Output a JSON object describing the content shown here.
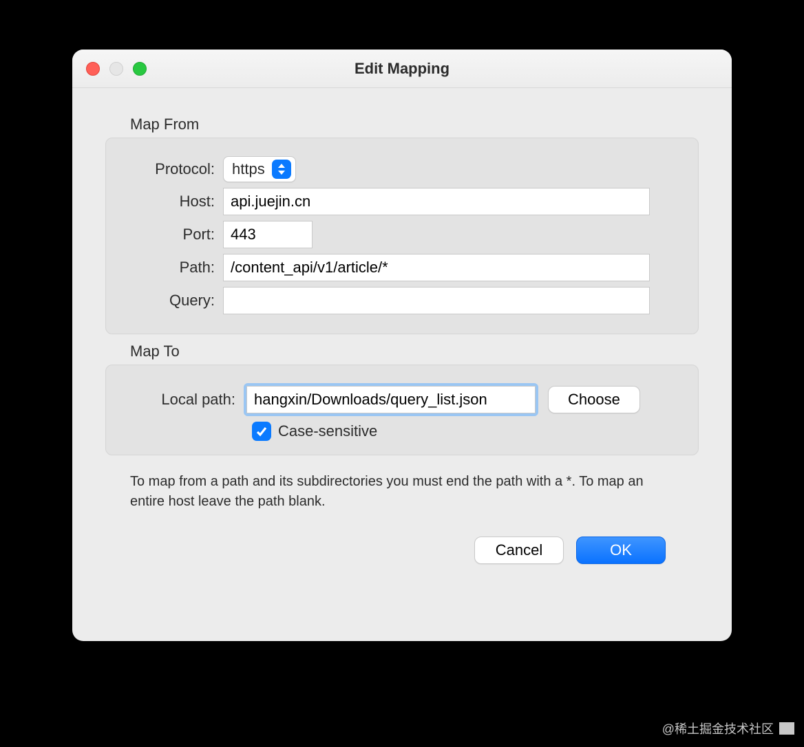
{
  "window": {
    "title": "Edit Mapping"
  },
  "map_from": {
    "group_label": "Map From",
    "protocol_label": "Protocol:",
    "protocol_value": "https",
    "host_label": "Host:",
    "host_value": "api.juejin.cn",
    "port_label": "Port:",
    "port_value": "443",
    "path_label": "Path:",
    "path_value": "/content_api/v1/article/*",
    "query_label": "Query:",
    "query_value": ""
  },
  "map_to": {
    "group_label": "Map To",
    "local_path_label": "Local path:",
    "local_path_value": "hangxin/Downloads/query_list.json",
    "choose_label": "Choose",
    "case_sensitive_label": "Case-sensitive",
    "case_sensitive_checked": true
  },
  "hint": "To map from a path and its subdirectories you must end the path with a *. To map an entire host leave the path blank.",
  "buttons": {
    "cancel": "Cancel",
    "ok": "OK"
  },
  "watermark": "@稀土掘金技术社区"
}
